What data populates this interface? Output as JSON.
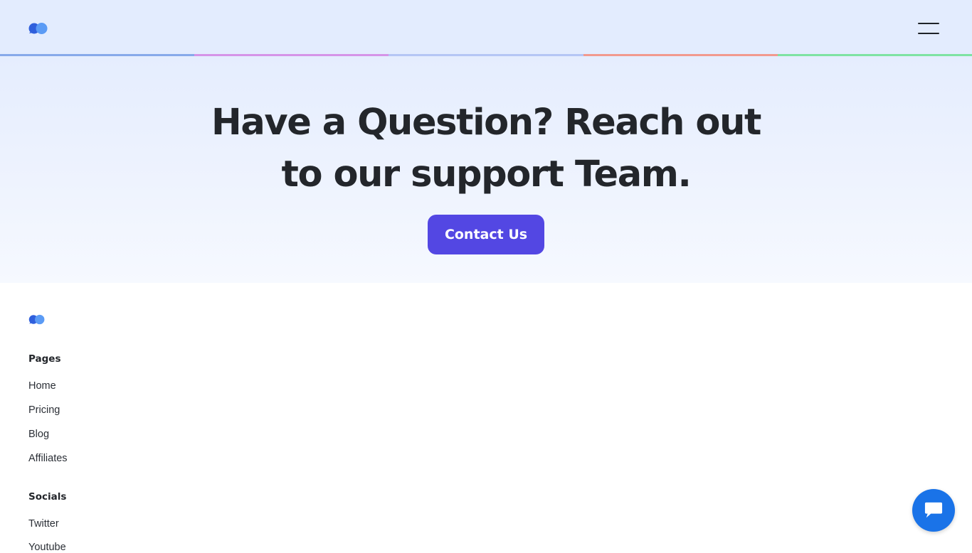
{
  "header": {
    "logo_icon": "chat-bubbles-logo",
    "menu_icon": "hamburger-menu-icon",
    "background": "#e3ecfe",
    "strip_colors": [
      "#87a9ea",
      "#d594e8",
      "#b5c6f5",
      "#f29a8e",
      "#7ee3a3"
    ]
  },
  "hero": {
    "title": "Have a Question? Reach out to our support Team.",
    "contact_button_label": "Contact Us",
    "button_color": "#5347e3"
  },
  "footer": {
    "logo_icon": "chat-bubbles-logo",
    "pages_heading": "Pages",
    "pages_links": [
      "Home",
      "Pricing",
      "Blog",
      "Affiliates"
    ],
    "socials_heading": "Socials",
    "socials_links": [
      "Twitter",
      "Youtube"
    ]
  },
  "chat_widget": {
    "icon": "chat-bubble-icon",
    "color": "#1a73e8"
  }
}
